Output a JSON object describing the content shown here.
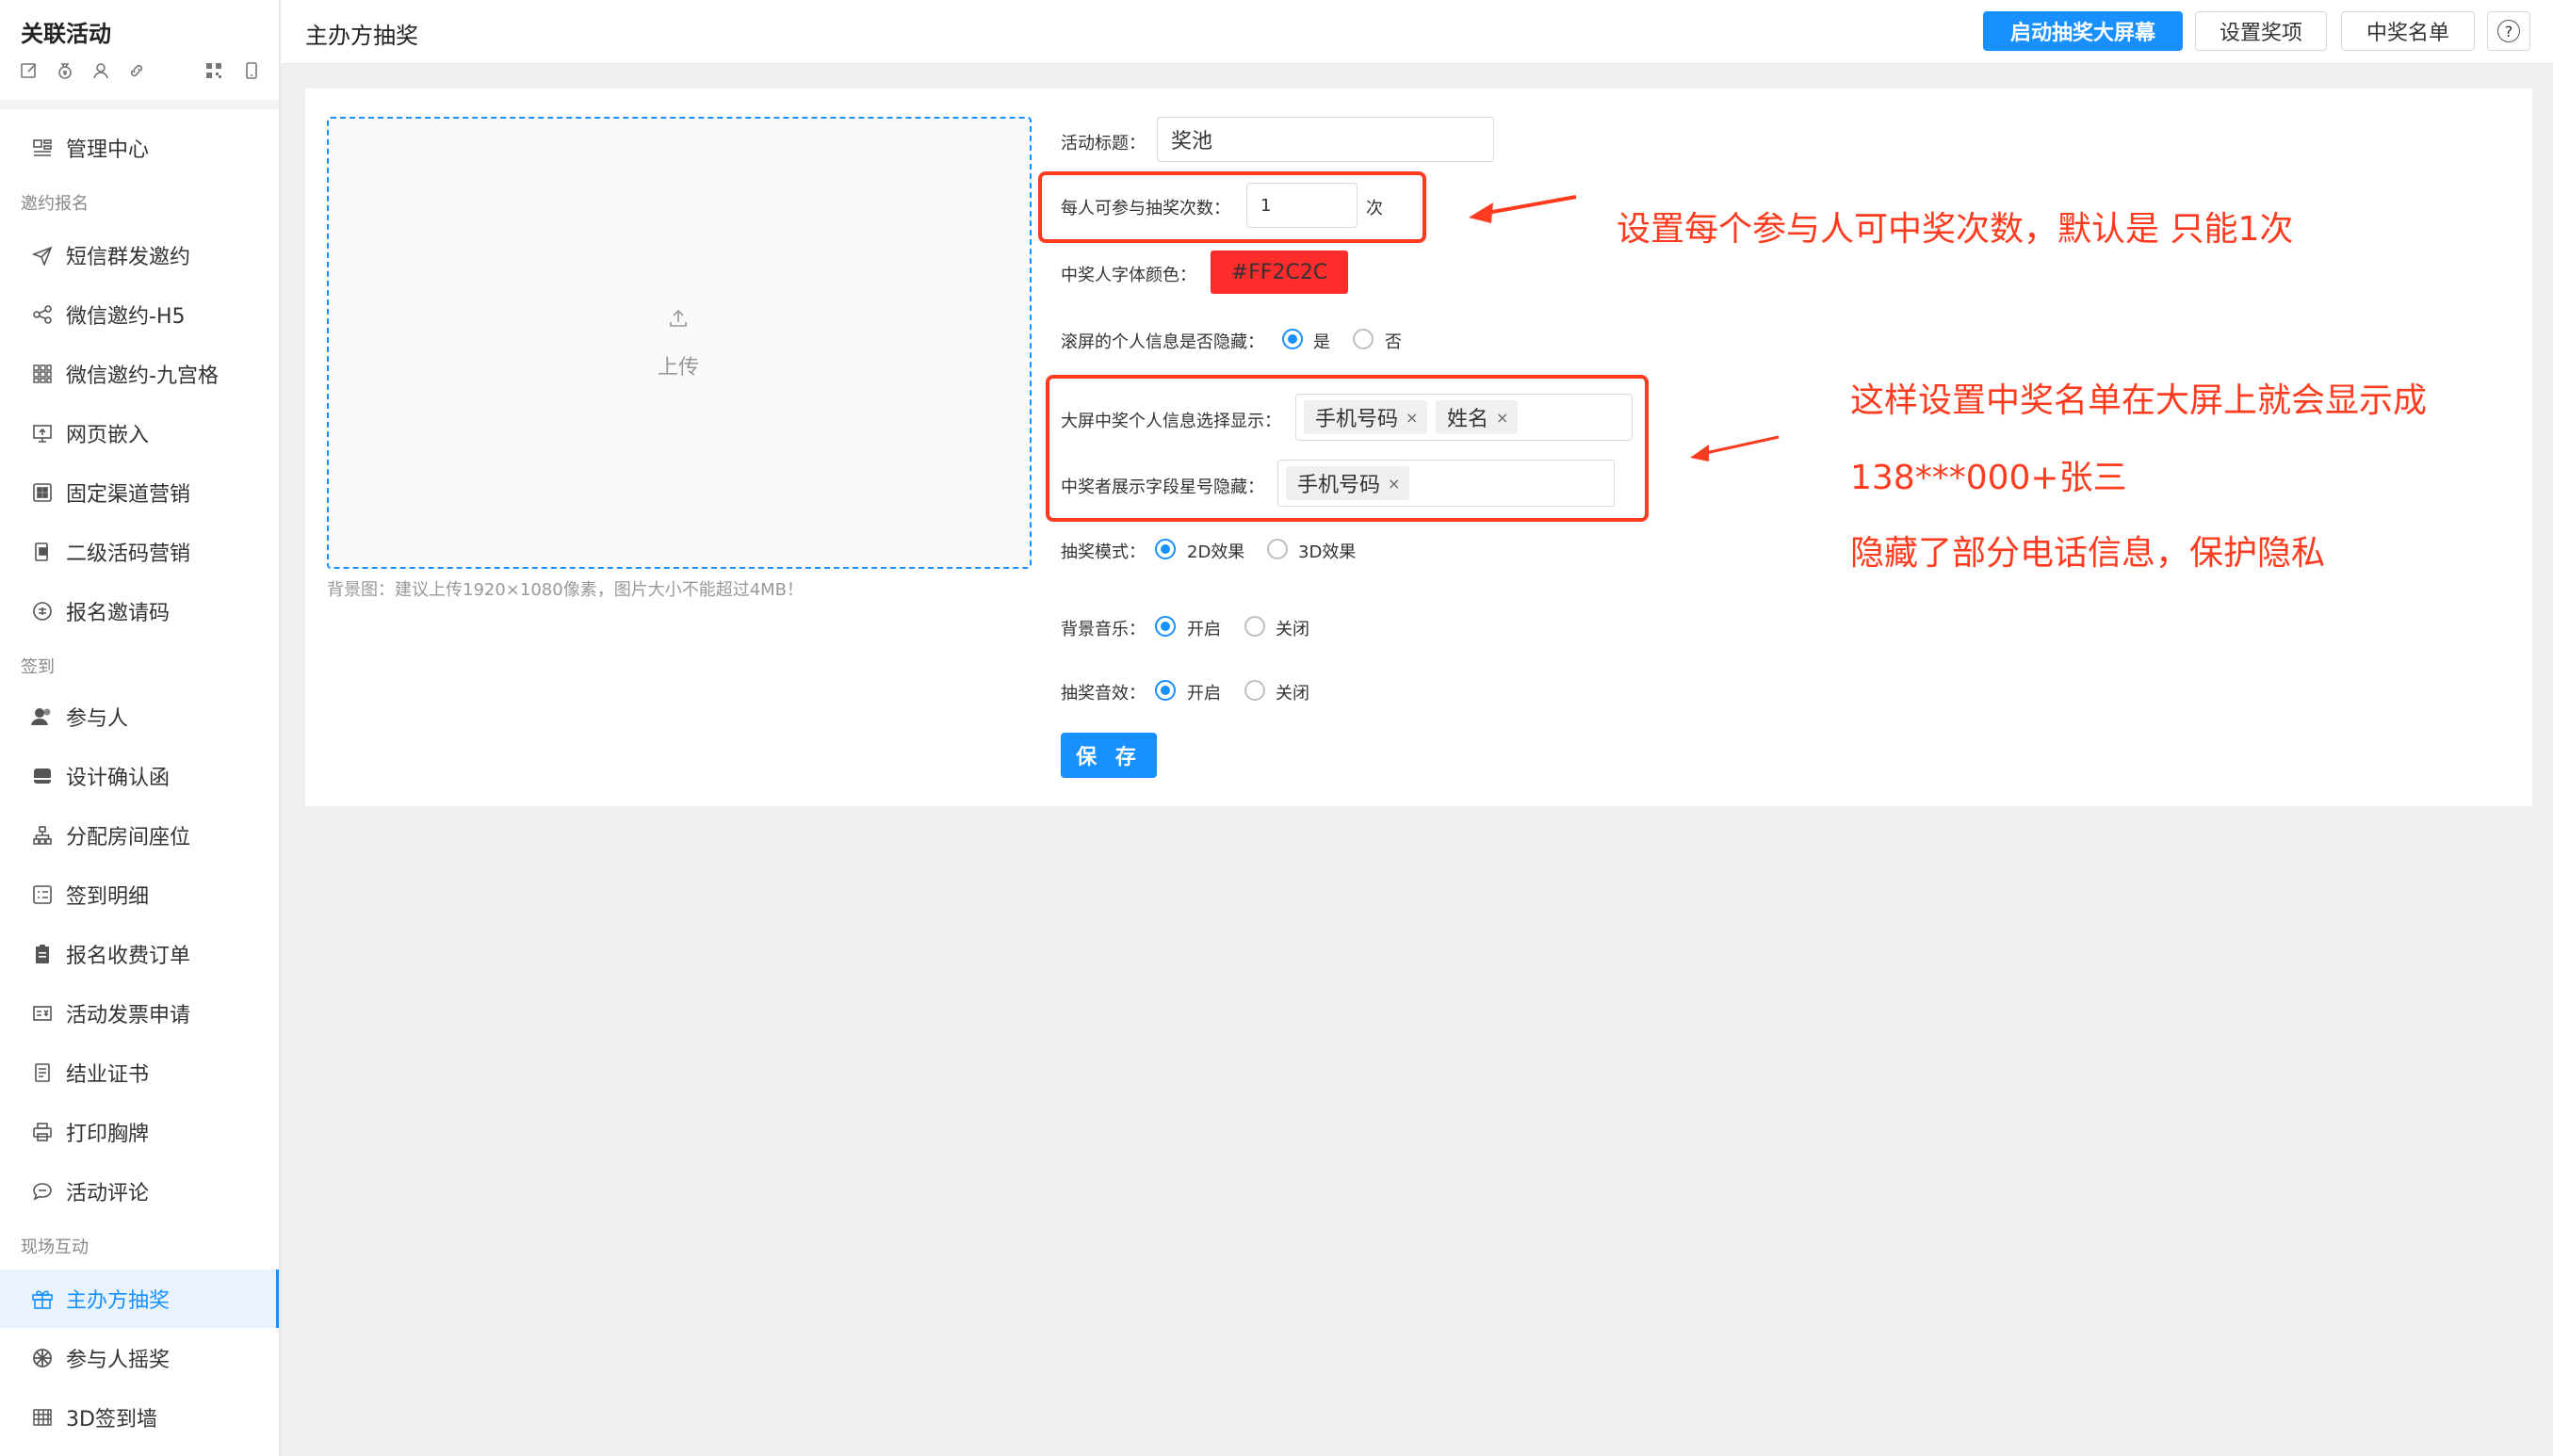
{
  "app": {
    "title": "关联活动"
  },
  "toolbar_icons": [
    "edit-icon",
    "money-bag-icon",
    "user-icon",
    "link-icon",
    "qrcode-icon",
    "mobile-icon"
  ],
  "sidebar": {
    "items": [
      {
        "label": "管理中心",
        "icon": "dashboard-icon"
      },
      {
        "group": "邀约报名"
      },
      {
        "label": "短信群发邀约",
        "icon": "send-icon"
      },
      {
        "label": "微信邀约-H5",
        "icon": "share-icon"
      },
      {
        "label": "微信邀约-九宫格",
        "icon": "grid-icon"
      },
      {
        "label": "网页嵌入",
        "icon": "embed-icon"
      },
      {
        "label": "固定渠道营销",
        "icon": "channel-icon"
      },
      {
        "label": "二级活码营销",
        "icon": "qrcode-marketing-icon"
      },
      {
        "label": "报名邀请码",
        "icon": "invite-code-icon"
      },
      {
        "group": "签到"
      },
      {
        "label": "参与人",
        "icon": "participants-icon"
      },
      {
        "label": "设计确认函",
        "icon": "letter-icon"
      },
      {
        "label": "分配房间座位",
        "icon": "seat-icon"
      },
      {
        "label": "签到明细",
        "icon": "checkin-list-icon"
      },
      {
        "label": "报名收费订单",
        "icon": "order-icon"
      },
      {
        "label": "活动发票申请",
        "icon": "invoice-icon"
      },
      {
        "label": "结业证书",
        "icon": "certificate-icon"
      },
      {
        "label": "打印胸牌",
        "icon": "printer-icon"
      },
      {
        "label": "活动评论",
        "icon": "comment-icon"
      },
      {
        "group": "现场互动"
      },
      {
        "label": "主办方抽奖",
        "icon": "gift-icon",
        "active": true
      },
      {
        "label": "参与人摇奖",
        "icon": "wheel-icon"
      },
      {
        "label": "3D签到墙",
        "icon": "wall-icon"
      }
    ]
  },
  "header": {
    "title": "主办方抽奖",
    "buttons": {
      "start": "启动抽奖大屏幕",
      "prizes": "设置奖项",
      "winners": "中奖名单",
      "help": "?"
    }
  },
  "upload": {
    "label": "上传",
    "hint": "背景图：建议上传1920×1080像素，图片大小不能超过4MB！"
  },
  "form": {
    "title_label": "活动标题：",
    "title_value": "奖池",
    "times_label": "每人可参与抽奖次数：",
    "times_value": "1",
    "times_unit": "次",
    "font_color_label": "中奖人字体颜色：",
    "font_color_value": "#FF2C2C",
    "hide_info_label": "滚屏的个人信息是否隐藏：",
    "hide_info_yes": "是",
    "hide_info_no": "否",
    "hide_info_selected": "是",
    "display_fields_label": "大屏中奖个人信息选择显示：",
    "display_fields": [
      "手机号码",
      "姓名"
    ],
    "mask_fields_label": "中奖者展示字段星号隐藏：",
    "mask_fields": [
      "手机号码"
    ],
    "mode_label": "抽奖模式：",
    "mode_2d": "2D效果",
    "mode_3d": "3D效果",
    "mode_selected": "2D效果",
    "music_label": "背景音乐：",
    "music_on": "开启",
    "music_off": "关闭",
    "music_selected": "开启",
    "sfx_label": "抽奖音效：",
    "sfx_on": "开启",
    "sfx_off": "关闭",
    "sfx_selected": "开启",
    "save": "保 存",
    "tag_close": "×"
  },
  "annotations": {
    "note1": "设置每个参与人可中奖次数，默认是 只能1次",
    "note2_line1": "这样设置中奖名单在大屏上就会显示成",
    "note2_line2": "138***000+张三",
    "note2_line3": "隐藏了部分电话信息，保护隐私",
    "color": "#ff3b1f"
  }
}
